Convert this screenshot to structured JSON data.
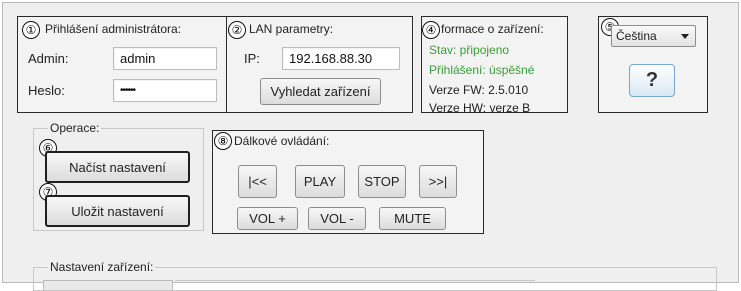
{
  "admin_group": {
    "badge": "①",
    "title": "Přihlášení administrátora:",
    "admin_label": "Admin:",
    "admin_value": "admin",
    "password_label": "Heslo:",
    "password_value": "••••••"
  },
  "lan_group": {
    "badge": "②",
    "title": "LAN parametry:",
    "ip_label": "IP:",
    "ip_value": "192.168.88.30",
    "search_button": "Vyhledat zařízení"
  },
  "device_info": {
    "badge": "④",
    "title": "formace o zařízení:",
    "status": "Stav: připojeno",
    "login": "Přihlášení: úspěšné",
    "fw_version": "Verze FW: 2.5.010",
    "hw_version": "Verze HW: verze B",
    "status_color": "#3a9b3a"
  },
  "language_group": {
    "badge": "⑤",
    "selected_language": "Čeština",
    "help_symbol": "?"
  },
  "operations": {
    "title": "Operace:",
    "load_badge": "⑥",
    "load_button": "Načíst nastavení",
    "save_badge": "⑦",
    "save_button": "Uložit nastavení"
  },
  "remote": {
    "badge": "⑧",
    "title": "Dálkové ovládání:",
    "prev": "|<<",
    "play": "PLAY",
    "stop": "STOP",
    "next": ">>|",
    "vol_up": "VOL +",
    "vol_down": "VOL -",
    "mute": "MUTE"
  },
  "settings": {
    "title": "Nastavení zařízení:"
  }
}
